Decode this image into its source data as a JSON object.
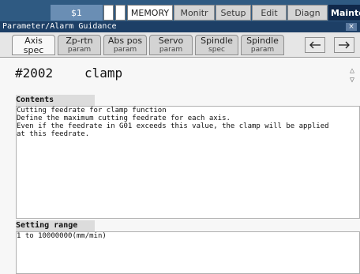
{
  "topbar": {
    "channel": "$1",
    "mode": "MEMORY",
    "menus": [
      "Monitr",
      "Setup",
      "Edit",
      "Diagn"
    ],
    "active_menu": "Mainte"
  },
  "window": {
    "title": "Parameter/Alarm Guidance",
    "close_label": "×"
  },
  "tabs": [
    {
      "line1": "Axis",
      "line2": "spec",
      "active": true
    },
    {
      "line1": "Zp-rtn",
      "line2": "param",
      "active": false
    },
    {
      "line1": "Abs pos",
      "line2": "param",
      "active": false
    },
    {
      "line1": "Servo",
      "line2": "param",
      "active": false
    },
    {
      "line1": "Spindle",
      "line2": "spec",
      "active": false
    },
    {
      "line1": "Spindle",
      "line2": "param",
      "active": false
    }
  ],
  "nav": {
    "back_icon": "arrow-left-icon",
    "forward_icon": "arrow-right-icon"
  },
  "parameter": {
    "number": "#2002",
    "name": "clamp"
  },
  "contents": {
    "heading": "Contents",
    "lines": [
      "Cutting feedrate for clamp function",
      "Define the maximum cutting feedrate for each axis.",
      "Even if the feedrate in G01 exceeds this value, the clamp will be applied",
      "at this feedrate."
    ]
  },
  "setting_range": {
    "heading": "Setting range",
    "value": "1 to 10000000(mm/min)"
  }
}
